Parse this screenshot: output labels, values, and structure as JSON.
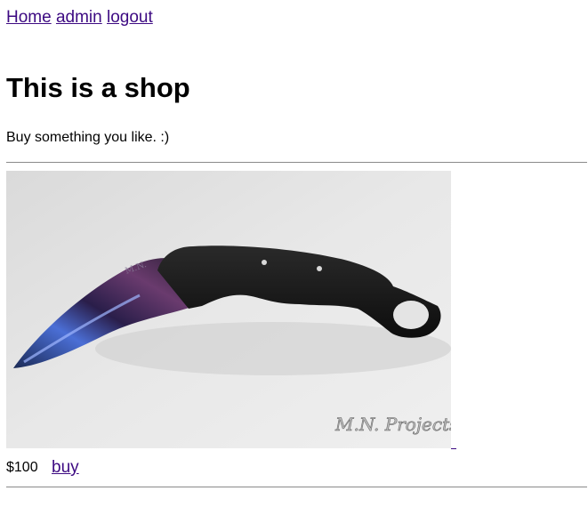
{
  "nav": {
    "home": "Home",
    "admin": "admin",
    "logout": "logout"
  },
  "page": {
    "title": "This is a shop",
    "tagline": "Buy something you like. :)"
  },
  "products": [
    {
      "image_icon": "karambit-knife-photo",
      "watermark": "M.N. Projects",
      "price": "$100",
      "buy_label": "buy"
    }
  ],
  "colors": {
    "link": "#3d0a82",
    "rule": "#8a8a8a",
    "image_bg": "#e6e6e6"
  }
}
